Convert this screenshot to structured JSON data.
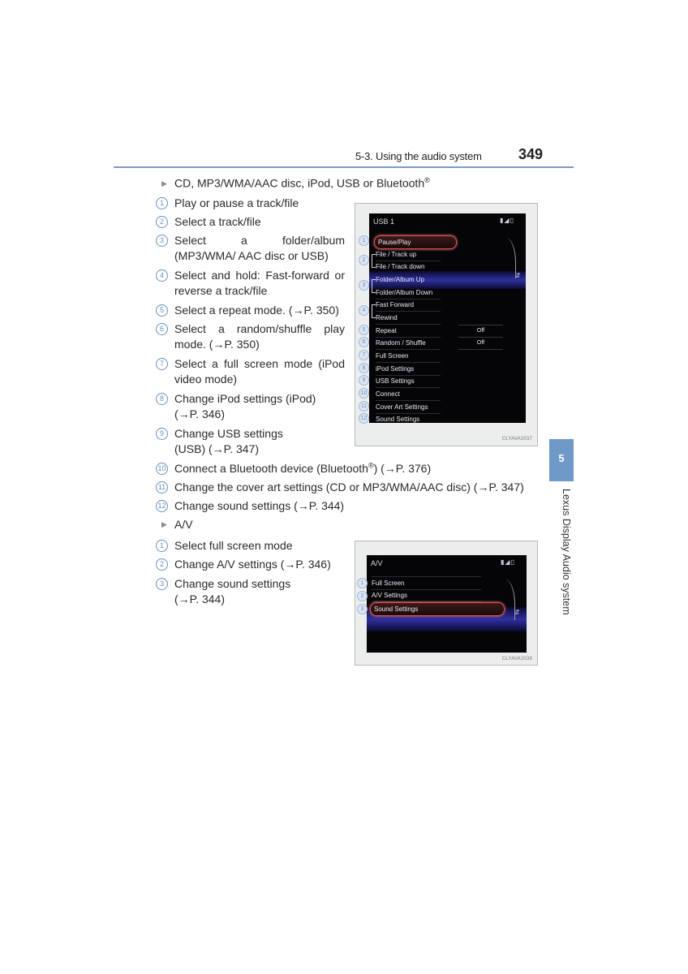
{
  "header": {
    "section_title": "5-3. Using the audio system",
    "page_number": "349",
    "rule_color": "#7d9cc2"
  },
  "section_usb": {
    "bullet": "CD, MP3/WMA/AAC disc, iPod, USB or Bluetooth",
    "bullet_mark": "®",
    "items": [
      {
        "num": "1",
        "text": "Play or pause a track/file"
      },
      {
        "num": "2",
        "text": "Select a track/file"
      },
      {
        "num": "3",
        "text": "Select a folder/album (MP3/WMA/ AAC disc or USB)"
      },
      {
        "num": "4",
        "text": "Select and hold: Fast-forward or reverse a track/file"
      },
      {
        "num": "5",
        "text": "Select a repeat mode. (→P. 350)"
      },
      {
        "num": "6",
        "text": "Select a random/shuffle play mode. (→P. 350)"
      },
      {
        "num": "7",
        "text": "Select a full screen mode (iPod video mode)"
      },
      {
        "num": "8",
        "text": "Change iPod settings (iPod) (→P. 346)"
      },
      {
        "num": "9",
        "text": "Change USB settings (USB) (→P. 347)"
      },
      {
        "num": "10",
        "text_before": "Connect a Bluetooth device (Bluetooth",
        "mark": "®",
        "text_after": ") (→P. 376)"
      },
      {
        "num": "11",
        "text": "Change the cover art settings (CD or MP3/WMA/AAC disc) (→P. 347)"
      },
      {
        "num": "12",
        "text": "Change sound settings (→P. 344)"
      }
    ],
    "screen": {
      "title": "USB 1",
      "status_icons": [
        "bluetooth-icon",
        "signal-icon",
        "battery-icon"
      ],
      "status_glyphs": "▮◢▯",
      "menu": [
        {
          "callout": "1",
          "label": "Pause/Play"
        },
        {
          "callout": "2",
          "label": "File / Track up"
        },
        {
          "callout": "",
          "label": "File / Track down"
        },
        {
          "callout": "3",
          "label": "Folder/Album Up"
        },
        {
          "callout": "",
          "label": "Folder/Album Down"
        },
        {
          "callout": "4",
          "label": "Fast Forward"
        },
        {
          "callout": "",
          "label": "Rewind"
        },
        {
          "callout": "5",
          "label": "Repeat",
          "value": "Off"
        },
        {
          "callout": "6",
          "label": "Random / Shuffle",
          "value": "Off"
        },
        {
          "callout": "7",
          "label": "Full Screen"
        },
        {
          "callout": "8",
          "label": "iPod Settings"
        },
        {
          "callout": "9",
          "label": "USB Settings"
        },
        {
          "callout": "10",
          "label": "Connect"
        },
        {
          "callout": "11",
          "label": "Cover Art Settings"
        },
        {
          "callout": "12",
          "label": "Sound Settings"
        }
      ],
      "image_code": "CLYAVA2037"
    }
  },
  "section_av": {
    "bullet": "A/V",
    "items": [
      {
        "num": "1",
        "text": "Select full screen mode"
      },
      {
        "num": "2",
        "text": "Change A/V settings (→P. 346)"
      },
      {
        "num": "3",
        "text": "Change sound settings (→P. 344)"
      }
    ],
    "screen": {
      "title": "A/V",
      "status_glyphs": "▮◢▯",
      "menu": [
        {
          "callout": "1",
          "label": "Full Screen"
        },
        {
          "callout": "2",
          "label": "A/V Settings"
        },
        {
          "callout": "3",
          "label": "Sound Settings"
        }
      ],
      "image_code": "CLYAVA2038"
    }
  },
  "side_tab": {
    "chapter_number": "5",
    "chapter_title": "Lexus Display Audio system",
    "color": "#6e99c8"
  }
}
